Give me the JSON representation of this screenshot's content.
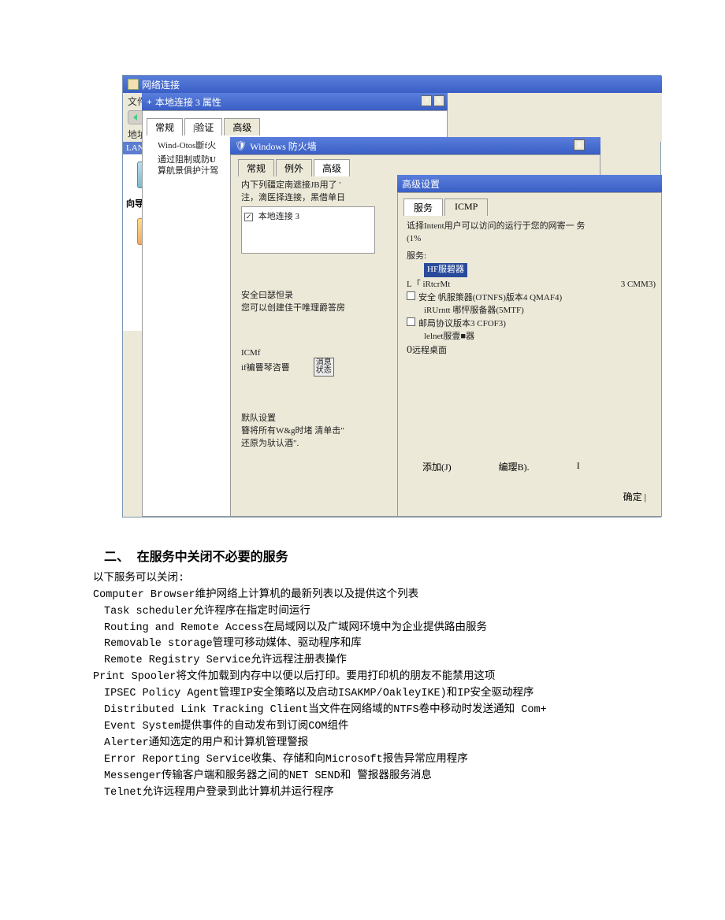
{
  "netconn": {
    "title": "网络连接",
    "menu": "文件 (F",
    "back": "后退",
    "addr_label": "地址 (D"
  },
  "side": {
    "lan": "LAN",
    "wizard": "向导"
  },
  "props": {
    "title": "本地连接 3 属性",
    "close_help": "?",
    "close_x": "X",
    "tab_general": "常规",
    "tab_auth": "|验证",
    "tab_adv": "高级",
    "line1": "Wind-Otos斷f火",
    "line2": "通过阻制或防",
    "line3": "算航景俱护汁驾",
    "box_label": "本地连接 3",
    "log_hdr": "安全曰瑟怛录",
    "log_txt": "您可以创建佳干唯理爵答房",
    "icmp_hdr": "ICMf",
    "icmp_txt": "if褊罾琴咨罾",
    "def_hdr": "默队设置",
    "def_txt1": "簪将所有W&g时堵 清单击\"",
    "def_txt2": "还原为驮认酒\"."
  },
  "fw": {
    "title": "Windows 防火墙",
    "tab_1": "常规",
    "tab_2": "例外",
    "tab_3": "高级",
    "conn_hdr1": "内下列疆定南遮接JB用了 '",
    "conn_hdr2": "注，滴医择连接，黑借单日"
  },
  "adv": {
    "title": "高级设置",
    "tab_svc": "服务",
    "tab_icmp": "ICMP",
    "hint1": "诋择Intent用户可以访问的运行于您的网寄一 务",
    "hint2": "(1%",
    "svc_label": "服务:",
    "svc_sel": "HF服碧器",
    "r1a": "L「 iRtcrMt",
    "r1b": "3 CMM3)",
    "r2": "安全 帆服策器(OTNFS)版本4 QMAF4)",
    "r3": "iRUrntt 哪怦服备器(5MTF)",
    "r4": "邮局协议版本3 CFOF3)",
    "r5": "lelnet服壹■器",
    "r6": "远程桌面",
    "zero": "0",
    "stamp1": "消息",
    "stamp2": "状态",
    "add": "添加(J)",
    "edit": "编璎B).",
    "del": "I",
    "ok": "确定 |"
  },
  "doc": {
    "heading": "二、 在服务中关闭不必要的服务",
    "l1": "以下服务可以关闭:",
    "l2": "Computer Browser维护网络上计算机的最新列表以及提供这个列表",
    "l3": "Task scheduler允许程序在指定时间运行",
    "l4": "Routing and Remote Access在局域网以及广域网环境中为企业提供路由服务",
    "l5": "Removable storage管理可移动媒体、驱动程序和库",
    "l6": "Remote Registry Service允许远程注册表操作",
    "l7": "Print Spooler将文件加载到内存中以便以后打印。要用打印机的朋友不能禁用这项",
    "l8": "IPSEC Policy Agent管理IP安全策略以及启动ISAKMP/OakleyIKE)和IP安全驱动程序",
    "l9": "Distributed Link Tracking Client当文件在网络域的NTFS卷中移动时发送通知 Com+",
    "l10": "Event System提供事件的自动发布到订阅COM组件",
    "l11": "Alerter通知选定的用户和计算机管理警报",
    "l12": "Error Reporting Service收集、存储和向Microsoft报告异常应用程序",
    "l13": "Messenger传输客户端和服务器之间的NET SEND和 警报器服务消息",
    "l14": "Telnet允许远程用户登录到此计算机并运行程序"
  }
}
